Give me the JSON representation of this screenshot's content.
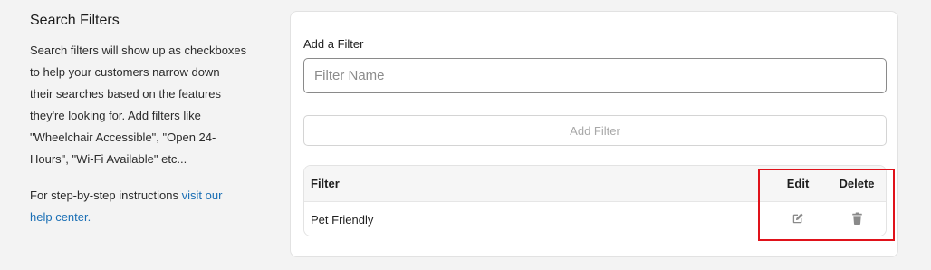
{
  "sidebar": {
    "title": "Search Filters",
    "description_lines": [
      "Search filters will show up as checkboxes",
      "to help your customers narrow down",
      "their searches based on the features",
      "they're looking for. Add filters like",
      "\"Wheelchair Accessible\", \"Open 24-",
      "Hours\", \"Wi-Fi Available\" etc..."
    ],
    "instructions_prefix": "For step-by-step instructions",
    "help_link_line1": "visit our",
    "help_link_line2": "help center."
  },
  "form": {
    "add_label": "Add a Filter",
    "input_placeholder": "Filter Name",
    "input_value": "",
    "add_button_label": "Add Filter"
  },
  "table": {
    "headers": {
      "filter": "Filter",
      "edit": "Edit",
      "delete": "Delete"
    },
    "rows": [
      {
        "name": "Pet Friendly",
        "edit_icon": "edit-icon",
        "delete_icon": "trash-icon"
      }
    ]
  },
  "colors": {
    "link": "#1a6fb5",
    "highlight": "#e0121a",
    "icon": "#8a8a8a",
    "disabled_text": "#a8a8a8"
  }
}
